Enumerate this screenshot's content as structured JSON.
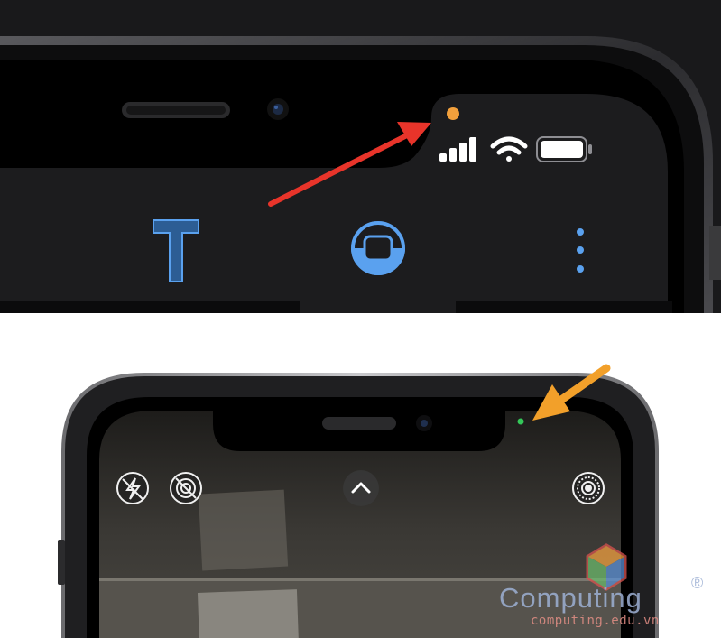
{
  "top_panel": {
    "indicator_color": "#f2a03c",
    "arrow_color": "#e8342a",
    "accent_color": "#4a90e2",
    "icons": [
      "orange-dot-indicator",
      "cellular-signal-icon",
      "wifi-icon",
      "battery-icon",
      "text-tool-icon",
      "record-button-icon",
      "more-options-icon"
    ]
  },
  "bottom_panel": {
    "indicator_color": "#34c759",
    "arrow_color": "#f2a02a",
    "icons": [
      "flash-off-icon",
      "live-photo-off-icon",
      "chevron-up-icon",
      "live-photo-icon"
    ]
  },
  "watermark": {
    "brand": "Computing",
    "registered": "®",
    "url": "computing.edu.vn"
  }
}
